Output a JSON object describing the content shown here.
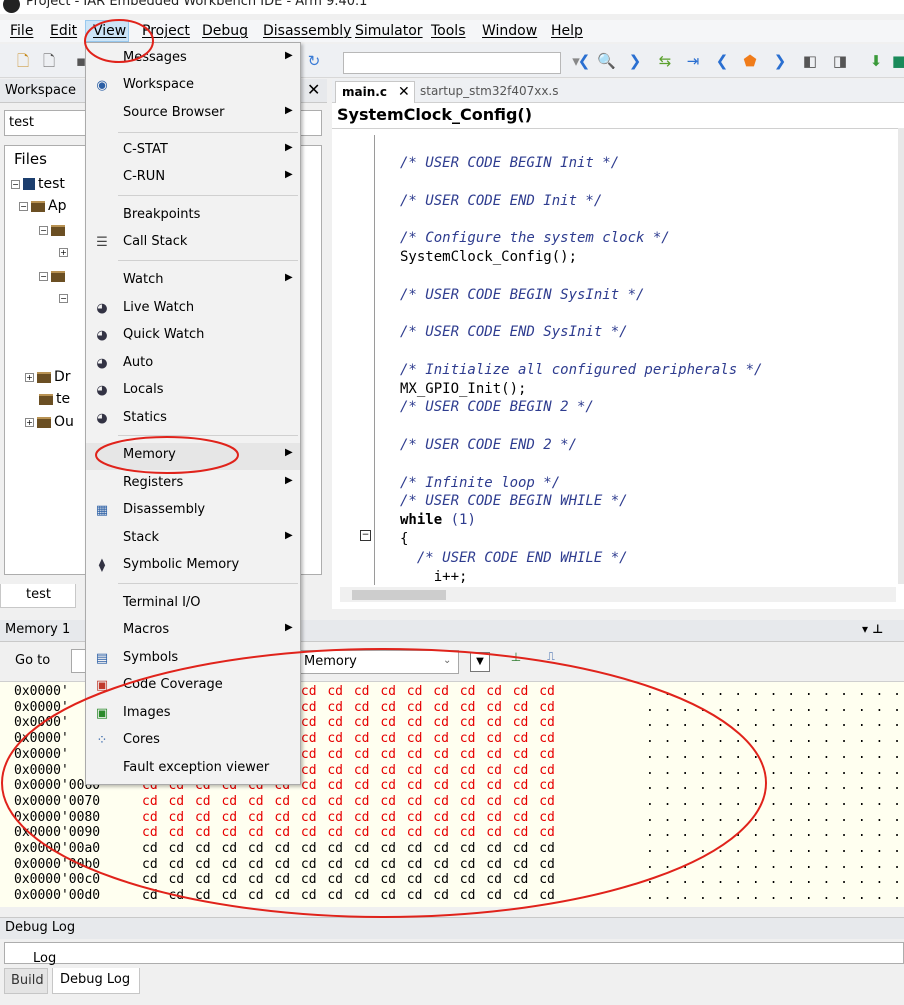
{
  "window": {
    "title": "Project - IAR Embedded Workbench IDE - Arm 9.40.1"
  },
  "menubar": [
    "File",
    "Edit",
    "View",
    "Project",
    "Debug",
    "Disassembly",
    "Simulator",
    "Tools",
    "Window",
    "Help"
  ],
  "workspace": {
    "title": "Workspace",
    "selected": "test",
    "tree_header": "Files",
    "root": "test",
    "tab": "test",
    "nodes": [
      "Ap",
      "Dr",
      "te",
      "Ou"
    ]
  },
  "editor": {
    "tabs": [
      "main.c",
      "startup_stm32f407xx.s"
    ],
    "function": "SystemClock_Config()",
    "lines": [
      {
        "t": "cmt",
        "v": "/* USER CODE BEGIN Init */"
      },
      {
        "t": "",
        "v": ""
      },
      {
        "t": "cmt",
        "v": "/* USER CODE END Init */"
      },
      {
        "t": "",
        "v": ""
      },
      {
        "t": "cmt",
        "v": "/* Configure the system clock */"
      },
      {
        "t": "code",
        "v": "SystemClock_Config();"
      },
      {
        "t": "",
        "v": ""
      },
      {
        "t": "cmt",
        "v": "/* USER CODE BEGIN SysInit */"
      },
      {
        "t": "",
        "v": ""
      },
      {
        "t": "cmt",
        "v": "/* USER CODE END SysInit */"
      },
      {
        "t": "",
        "v": ""
      },
      {
        "t": "cmt",
        "v": "/* Initialize all configured peripherals */"
      },
      {
        "t": "code",
        "v": "MX_GPIO_Init();"
      },
      {
        "t": "cmt",
        "v": "/* USER CODE BEGIN 2 */"
      },
      {
        "t": "",
        "v": ""
      },
      {
        "t": "cmt",
        "v": "/* USER CODE END 2 */"
      },
      {
        "t": "",
        "v": ""
      },
      {
        "t": "cmt",
        "v": "/* Infinite loop */"
      },
      {
        "t": "cmt",
        "v": "/* USER CODE BEGIN WHILE */"
      },
      {
        "t": "while",
        "v": "while",
        "n": "(1)"
      },
      {
        "t": "code",
        "v": "{"
      },
      {
        "t": "cmt2",
        "v": "  /* USER CODE END WHILE */"
      },
      {
        "t": "code",
        "v": "    i++;"
      }
    ]
  },
  "memory": {
    "title": "Memory 1",
    "goto_label": "Go to",
    "zone": "Memory",
    "byte": "cd",
    "ascii": ". . . . . . . . . . . . . . . .",
    "rows": [
      {
        "addr": "0x0000'",
        "red": true
      },
      {
        "addr": "0x0000'",
        "red": true
      },
      {
        "addr": "0x0000'",
        "red": true
      },
      {
        "addr": "0x0000'",
        "red": true
      },
      {
        "addr": "0x0000'",
        "red": true
      },
      {
        "addr": "0x0000'",
        "red": true
      },
      {
        "addr": "0x0000'0060",
        "red": true
      },
      {
        "addr": "0x0000'0070",
        "red": true
      },
      {
        "addr": "0x0000'0080",
        "red": true
      },
      {
        "addr": "0x0000'0090",
        "red": true
      },
      {
        "addr": "0x0000'00a0",
        "red": false
      },
      {
        "addr": "0x0000'00b0",
        "red": false
      },
      {
        "addr": "0x0000'00c0",
        "red": false
      },
      {
        "addr": "0x0000'00d0",
        "red": false
      }
    ]
  },
  "debug_log": {
    "title": "Debug Log",
    "column": "Log"
  },
  "bottom_tabs": [
    "Build",
    "Debug Log"
  ],
  "view_menu": {
    "items": [
      {
        "label": "Messages",
        "sub": true,
        "icon": ""
      },
      {
        "label": "Workspace",
        "sub": false,
        "icon": "workspace-icon"
      },
      {
        "label": "Source Browser",
        "sub": true,
        "icon": ""
      },
      {
        "label": "C-STAT",
        "sub": true,
        "icon": ""
      },
      {
        "label": "C-RUN",
        "sub": true,
        "icon": ""
      },
      {
        "label": "Breakpoints",
        "sub": false,
        "icon": ""
      },
      {
        "label": "Call Stack",
        "sub": false,
        "icon": "call-stack-icon"
      },
      {
        "label": "Watch",
        "sub": true,
        "icon": ""
      },
      {
        "label": "Live Watch",
        "sub": false,
        "icon": "live-watch-icon"
      },
      {
        "label": "Quick Watch",
        "sub": false,
        "icon": "quick-watch-icon"
      },
      {
        "label": "Auto",
        "sub": false,
        "icon": "auto-icon"
      },
      {
        "label": "Locals",
        "sub": false,
        "icon": "locals-icon"
      },
      {
        "label": "Statics",
        "sub": false,
        "icon": "statics-icon"
      },
      {
        "label": "Memory",
        "sub": true,
        "icon": ""
      },
      {
        "label": "Registers",
        "sub": true,
        "icon": ""
      },
      {
        "label": "Disassembly",
        "sub": false,
        "icon": "disassembly-icon"
      },
      {
        "label": "Stack",
        "sub": true,
        "icon": ""
      },
      {
        "label": "Symbolic Memory",
        "sub": false,
        "icon": "symbolic-memory-icon"
      },
      {
        "label": "Terminal I/O",
        "sub": false,
        "icon": ""
      },
      {
        "label": "Macros",
        "sub": true,
        "icon": ""
      },
      {
        "label": "Symbols",
        "sub": false,
        "icon": "symbols-icon"
      },
      {
        "label": "Code Coverage",
        "sub": false,
        "icon": "code-coverage-icon"
      },
      {
        "label": "Images",
        "sub": false,
        "icon": "images-icon"
      },
      {
        "label": "Cores",
        "sub": false,
        "icon": "cores-icon"
      },
      {
        "label": "Fault exception viewer",
        "sub": false,
        "icon": ""
      }
    ]
  },
  "colors": {
    "annotation": "#e0231b",
    "memory_red": "#e60000",
    "memory_bg": "#fffff0"
  }
}
